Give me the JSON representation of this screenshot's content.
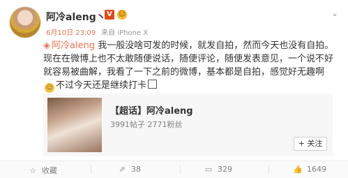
{
  "header": {
    "username": "阿冷aleng丶",
    "vip_label": "V",
    "badge_label": "☺",
    "timestamp": "6月10日 23:09",
    "source": "来自 iPhone X"
  },
  "post": {
    "mention": "阿冷aleng",
    "text_part1": " 我一般没啥可发的时候，就发自拍，然而今天也没有自拍。现在在微博上也不太敢随便说话，随便评论，随便发表意见，一个说不好就容易被曲解，我看了一下之前的微博，基本都是自拍，感觉好无趣啊",
    "text_part2": "不过今天还是继续打卡",
    "emoji_glyph": "☺"
  },
  "card": {
    "title": "【超话】阿冷aleng",
    "stats": "3991帖子 2771粉丝",
    "follow_label": "+ 关注"
  },
  "actions": {
    "favorite": "收藏",
    "repost": "38",
    "comment": "329",
    "like": "1649"
  }
}
